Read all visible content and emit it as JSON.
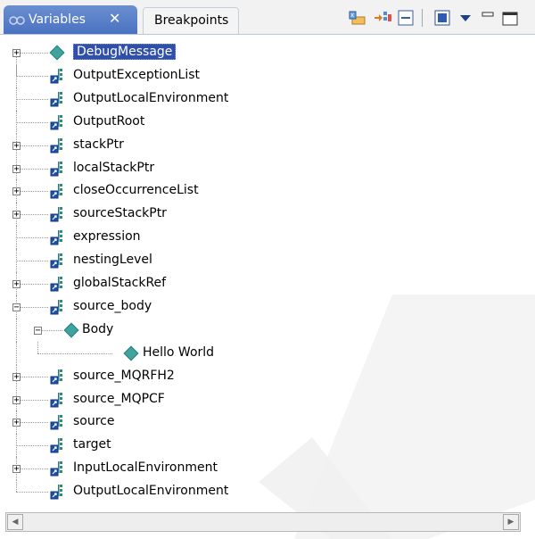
{
  "tabs": {
    "active_label": "Variables",
    "close_glyph": "✕",
    "inactive_label": "Breakpoints"
  },
  "toolbar": {
    "icons": [
      "show-type-names-icon",
      "show-logical-structure-icon",
      "collapse-all-icon",
      "toggle-detail-pane-icon",
      "view-menu-icon",
      "minimize-icon",
      "maximize-icon"
    ]
  },
  "tree": {
    "items": [
      {
        "label": "DebugMessage",
        "expandable": true,
        "expanded": false,
        "selected": true,
        "icon": "diamond"
      },
      {
        "label": "OutputExceptionList",
        "expandable": false,
        "icon": "variable"
      },
      {
        "label": "OutputLocalEnvironment",
        "expandable": false,
        "icon": "variable"
      },
      {
        "label": "OutputRoot",
        "expandable": false,
        "icon": "variable"
      },
      {
        "label": "stackPtr",
        "expandable": true,
        "expanded": false,
        "icon": "variable"
      },
      {
        "label": "localStackPtr",
        "expandable": true,
        "expanded": false,
        "icon": "variable"
      },
      {
        "label": "closeOccurrenceList",
        "expandable": true,
        "expanded": false,
        "icon": "variable"
      },
      {
        "label": "sourceStackPtr",
        "expandable": true,
        "expanded": false,
        "icon": "variable"
      },
      {
        "label": "expression",
        "expandable": false,
        "icon": "variable"
      },
      {
        "label": "nestingLevel",
        "expandable": false,
        "icon": "variable"
      },
      {
        "label": "globalStackRef",
        "expandable": true,
        "expanded": false,
        "icon": "variable"
      },
      {
        "label": "source_body",
        "expandable": true,
        "expanded": true,
        "icon": "variable"
      },
      {
        "label": "Body",
        "expandable": true,
        "expanded": true,
        "icon": "diamond",
        "level": 1
      },
      {
        "label": "Hello World",
        "expandable": false,
        "icon": "diamond",
        "level": 2
      },
      {
        "label": "source_MQRFH2",
        "expandable": true,
        "expanded": false,
        "icon": "variable"
      },
      {
        "label": "source_MQPCF",
        "expandable": true,
        "expanded": false,
        "icon": "variable"
      },
      {
        "label": "source",
        "expandable": true,
        "expanded": false,
        "icon": "variable"
      },
      {
        "label": "target",
        "expandable": false,
        "icon": "variable"
      },
      {
        "label": "InputLocalEnvironment",
        "expandable": true,
        "expanded": false,
        "icon": "variable"
      },
      {
        "label": "OutputLocalEnvironment",
        "expandable": false,
        "icon": "variable"
      }
    ]
  },
  "scrollbar": {
    "left_glyph": "◀",
    "right_glyph": "▶"
  },
  "colors": {
    "selection": "#2f4fa8",
    "active_tab": "#4a72c2",
    "diamond": "#3fa3a0"
  }
}
